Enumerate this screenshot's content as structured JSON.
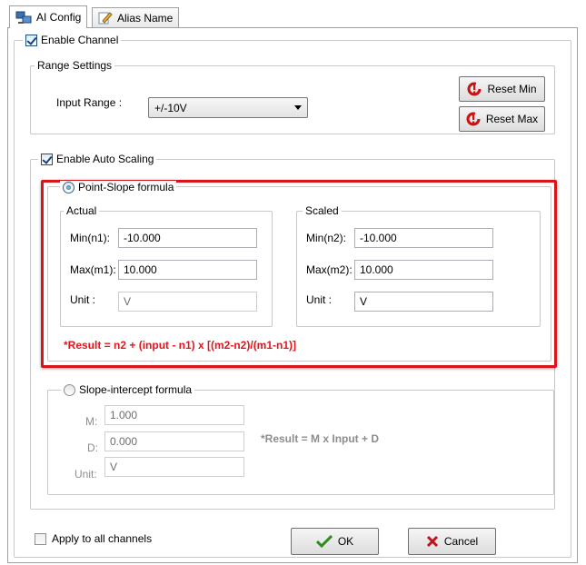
{
  "tabs": [
    {
      "label": "AI Config",
      "icon": "network-icon",
      "active": true
    },
    {
      "label": "Alias Name",
      "icon": "edit-icon",
      "active": false
    }
  ],
  "enable_channel": {
    "label": "Enable Channel",
    "checked": true
  },
  "range_settings": {
    "title": "Range Settings",
    "input_range_label": "Input Range :",
    "input_range_value": "+/-10V",
    "reset_min_label": "Reset Min",
    "reset_max_label": "Reset Max"
  },
  "auto_scaling": {
    "label": "Enable Auto Scaling",
    "checked": true,
    "point_slope": {
      "label": "Point-Slope formula",
      "selected": true,
      "actual": {
        "title": "Actual",
        "min_label": "Min(n1):",
        "min_value": "-10.000",
        "max_label": "Max(m1):",
        "max_value": "10.000",
        "unit_label": "Unit :",
        "unit_value": "V"
      },
      "scaled": {
        "title": "Scaled",
        "min_label": "Min(n2):",
        "min_value": "-10.000",
        "max_label": "Max(m2):",
        "max_value": "10.000",
        "unit_label": "Unit :",
        "unit_value": "V"
      },
      "formula": "*Result = n2 + (input - n1) x [(m2-n2)/(m1-n1)]"
    },
    "slope_intercept": {
      "label": "Slope-intercept formula",
      "selected": false,
      "m_label": "M:",
      "m_value": "1.000",
      "d_label": "D:",
      "d_value": "0.000",
      "unit_label": "Unit:",
      "unit_value": "V",
      "formula": "*Result = M x Input + D"
    }
  },
  "apply_all": {
    "label": "Apply to all channels",
    "checked": false
  },
  "buttons": {
    "ok_label": "OK",
    "cancel_label": "Cancel"
  },
  "colors": {
    "highlight_border": "#d9141b",
    "formula_text": "#e8141c"
  }
}
